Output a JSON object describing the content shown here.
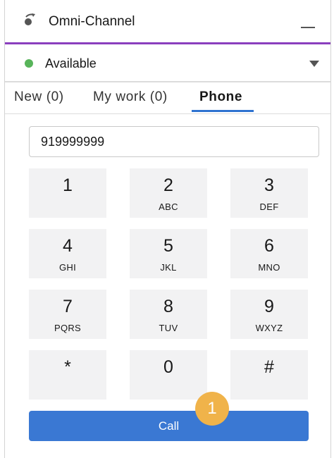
{
  "header": {
    "title": "Omni-Channel",
    "icon": "omni-channel-icon"
  },
  "status": {
    "label": "Available",
    "dot_color": "#58b45a"
  },
  "tabs": [
    {
      "label": "New (0)"
    },
    {
      "label": "My work (0)"
    },
    {
      "label": "Phone",
      "active": true
    }
  ],
  "dialer": {
    "number_value": "919999999",
    "keys": [
      {
        "digit": "1",
        "letters": ""
      },
      {
        "digit": "2",
        "letters": "ABC"
      },
      {
        "digit": "3",
        "letters": "DEF"
      },
      {
        "digit": "4",
        "letters": "GHI"
      },
      {
        "digit": "5",
        "letters": "JKL"
      },
      {
        "digit": "6",
        "letters": "MNO"
      },
      {
        "digit": "7",
        "letters": "PQRS"
      },
      {
        "digit": "8",
        "letters": "TUV"
      },
      {
        "digit": "9",
        "letters": "WXYZ"
      },
      {
        "digit": "*",
        "letters": ""
      },
      {
        "digit": "0",
        "letters": ""
      },
      {
        "digit": "#",
        "letters": ""
      }
    ],
    "call_label": "Call"
  },
  "step_badge": "1",
  "colors": {
    "accent": "#8a3fbe",
    "tab_active": "#2f73d0",
    "call_button": "#3a78d3",
    "badge": "#f0b34a"
  }
}
